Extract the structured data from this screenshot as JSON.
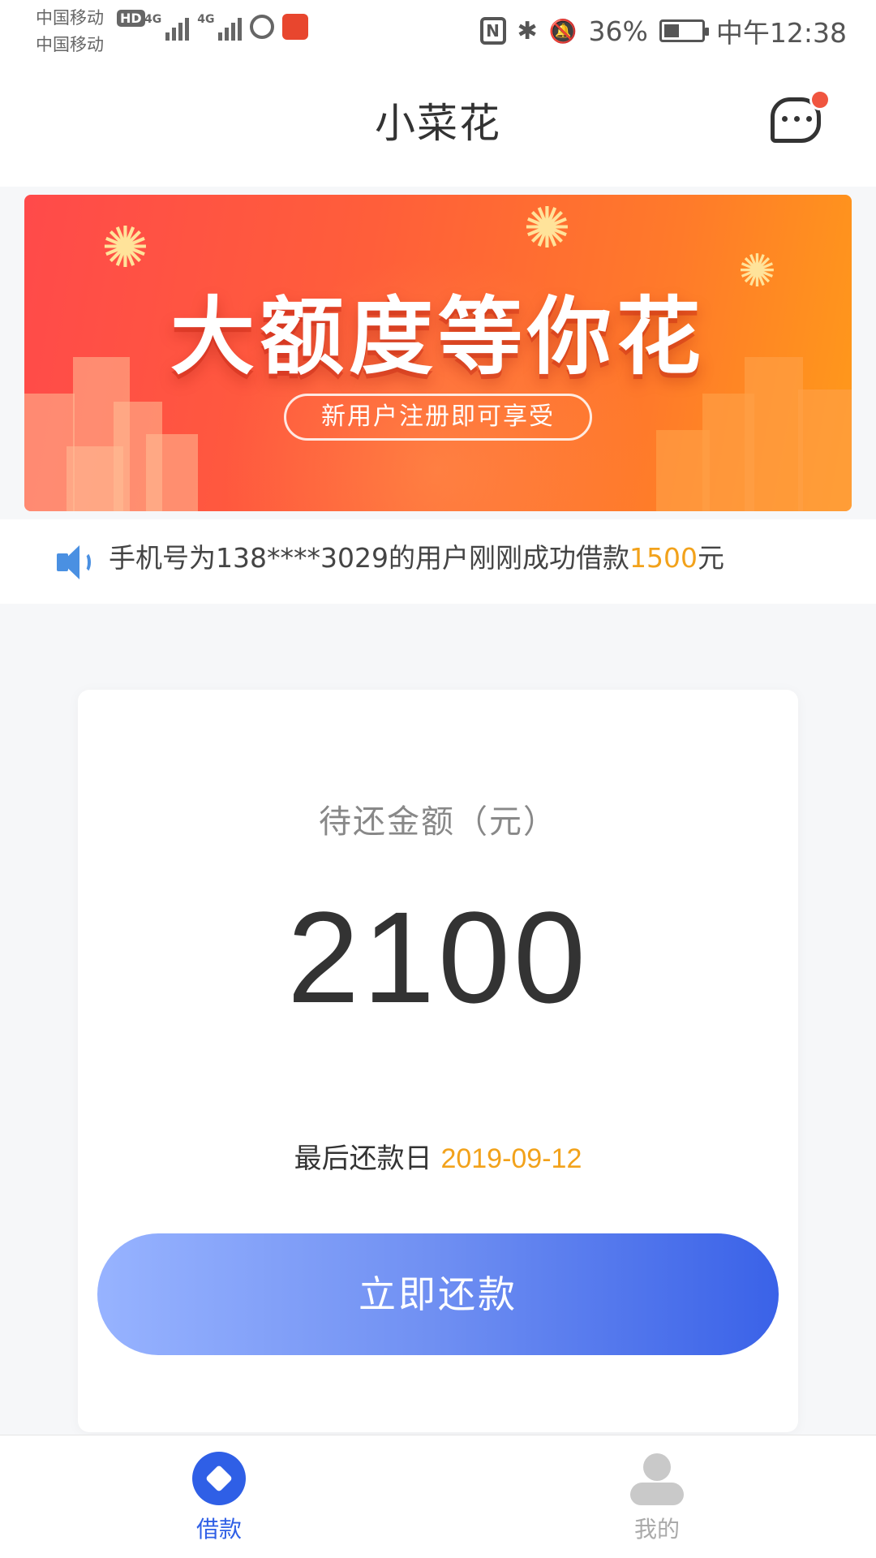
{
  "status_bar": {
    "carrier_1": "中国移动",
    "carrier_2": "中国移动",
    "hd": "HD",
    "net_1": "4G",
    "net_2": "4G",
    "nfc": "N",
    "battery_pct": "36%",
    "time": "中午12:38"
  },
  "header": {
    "title": "小菜花"
  },
  "banner": {
    "headline": "大额度等你花",
    "subtitle": "新用户注册即可享受"
  },
  "notice": {
    "text_prefix": "手机号为138****3029的用户刚刚成功借款",
    "amount": "1500",
    "unit": "元"
  },
  "repay_card": {
    "label": "待还金额（元）",
    "amount": "2100",
    "deadline_label": "最后还款日",
    "deadline_date": "2019-09-12",
    "button_label": "立即还款"
  },
  "tabbar": {
    "tabs": [
      {
        "label": "借款",
        "active": true
      },
      {
        "label": "我的",
        "active": false
      }
    ]
  },
  "colors": {
    "accent_blue": "#2f5fe6",
    "accent_orange": "#f2a21b",
    "banner_red": "#ff4a4a",
    "banner_orange": "#ff9a1a"
  }
}
